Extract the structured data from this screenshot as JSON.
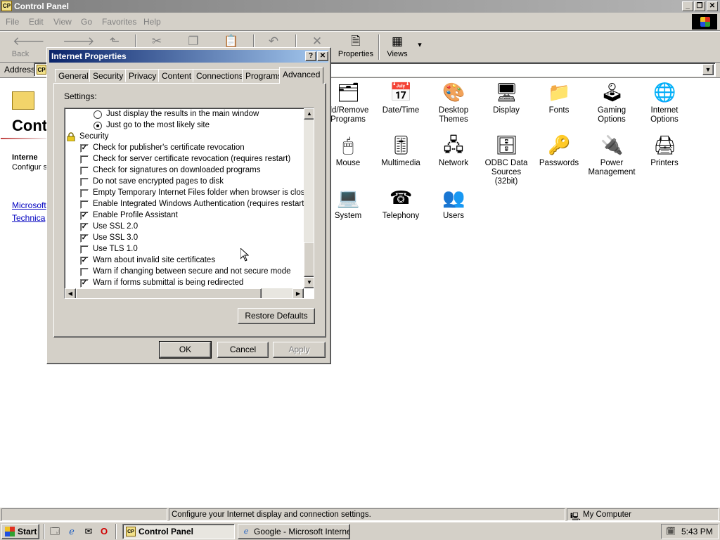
{
  "window": {
    "title": "Control Panel",
    "menu": [
      "File",
      "Edit",
      "View",
      "Go",
      "Favorites",
      "Help"
    ],
    "toolbar": {
      "back": "Back",
      "properties": "Properties",
      "views": "Views"
    },
    "address_label": "Address"
  },
  "left_pane": {
    "title": "Cont",
    "desc_title": "Interne",
    "desc": "Configur settings.",
    "links": [
      "Microsoft",
      "Technica"
    ]
  },
  "items": [
    {
      "label": "dd/Remove Programs",
      "icon": "add-remove-programs-icon"
    },
    {
      "label": "Date/Time",
      "icon": "calendar-clock-icon"
    },
    {
      "label": "Desktop Themes",
      "icon": "desktop-themes-icon"
    },
    {
      "label": "Display",
      "icon": "monitor-icon"
    },
    {
      "label": "Fonts",
      "icon": "fonts-folder-icon"
    },
    {
      "label": "Gaming Options",
      "icon": "joystick-icon"
    },
    {
      "label": "Internet Options",
      "icon": "globe-icon"
    },
    {
      "label": "Mouse",
      "icon": "mouse-icon"
    },
    {
      "label": "Multimedia",
      "icon": "multimedia-icon"
    },
    {
      "label": "Network",
      "icon": "network-icon"
    },
    {
      "label": "ODBC Data Sources (32bit)",
      "icon": "database-icon"
    },
    {
      "label": "Passwords",
      "icon": "keys-icon"
    },
    {
      "label": "Power Management",
      "icon": "power-plug-icon"
    },
    {
      "label": "Printers",
      "icon": "printers-folder-icon"
    },
    {
      "label": "System",
      "icon": "computer-icon"
    },
    {
      "label": "Telephony",
      "icon": "telephone-icon"
    },
    {
      "label": "Users",
      "icon": "users-icon"
    }
  ],
  "dialog": {
    "title": "Internet Properties",
    "tabs": [
      "General",
      "Security",
      "Privacy",
      "Content",
      "Connections",
      "Programs",
      "Advanced"
    ],
    "active_tab": "Advanced",
    "settings_label": "Settings:",
    "rows": [
      {
        "type": "radio",
        "checked": false,
        "label": "Just display the results in the main window"
      },
      {
        "type": "radio",
        "checked": true,
        "label": "Just go to the most likely site"
      },
      {
        "type": "group",
        "label": "Security"
      },
      {
        "type": "check",
        "checked": true,
        "label": "Check for publisher's certificate revocation"
      },
      {
        "type": "check",
        "checked": false,
        "label": "Check for server certificate revocation (requires restart)"
      },
      {
        "type": "check",
        "checked": false,
        "label": "Check for signatures on downloaded programs"
      },
      {
        "type": "check",
        "checked": false,
        "label": "Do not save encrypted pages to disk"
      },
      {
        "type": "check",
        "checked": false,
        "label": "Empty Temporary Internet Files folder when browser is closed"
      },
      {
        "type": "check",
        "checked": false,
        "label": "Enable Integrated Windows Authentication (requires restart)"
      },
      {
        "type": "check",
        "checked": true,
        "label": "Enable Profile Assistant"
      },
      {
        "type": "check",
        "checked": true,
        "label": "Use SSL 2.0"
      },
      {
        "type": "check",
        "checked": true,
        "label": "Use SSL 3.0"
      },
      {
        "type": "check",
        "checked": false,
        "label": "Use TLS 1.0"
      },
      {
        "type": "check",
        "checked": true,
        "label": "Warn about invalid site certificates"
      },
      {
        "type": "check",
        "checked": false,
        "label": "Warn if changing between secure and not secure mode"
      },
      {
        "type": "check",
        "checked": true,
        "label": "Warn if forms submittal is being redirected"
      }
    ],
    "restore_defaults": "Restore Defaults",
    "ok": "OK",
    "cancel": "Cancel",
    "apply": "Apply"
  },
  "statusbar": {
    "text": "Configure your Internet display and connection settings.",
    "zone": "My Computer"
  },
  "taskbar": {
    "start": "Start",
    "tasks": [
      "Control Panel",
      "Google - Microsoft Internet..."
    ],
    "clock": "5:43 PM"
  }
}
